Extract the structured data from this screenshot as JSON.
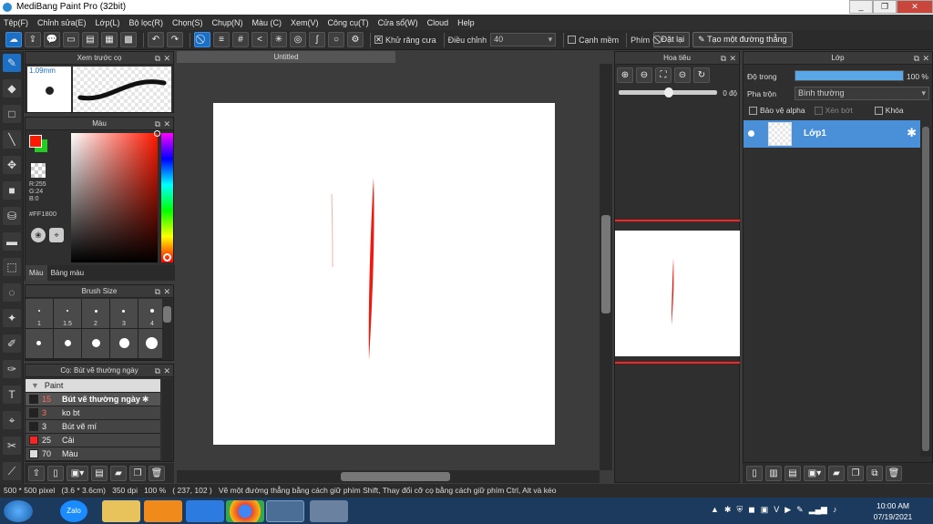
{
  "window": {
    "title": "MediBang Paint Pro (32bit)",
    "minimize": "_",
    "restore": "❐",
    "close": "✕"
  },
  "menu": [
    "Tệp(F)",
    "Chỉnh sửa(E)",
    "Lớp(L)",
    "Bộ lọc(R)",
    "Chọn(S)",
    "Chụp(N)",
    "Màu (C)",
    "Xem(V)",
    "Công cụ(T)",
    "Cửa sổ(W)",
    "Cloud",
    "Help"
  ],
  "toolbar": {
    "antialias_label": "Khử răng cưa",
    "adjust_label": "Điều chỉnh",
    "adjust_value": "40",
    "smooth_label": "Cạnh mềm",
    "key_label": "Phím",
    "reset_label": "Đặt lại",
    "straight_line_label": "Tạo một đường thẳng"
  },
  "brush_preview": {
    "title": "Xem trước cọ",
    "size": "1.09mm"
  },
  "color": {
    "title": "Màu",
    "r": "R:255",
    "g": "G:24",
    "b": "B:0",
    "hex": "#FF1800",
    "tab_color": "Màu",
    "tab_palette": "Bảng màu",
    "primary": "#ff1800",
    "secondary": "#22cc22"
  },
  "brush_size": {
    "title": "Brush Size",
    "labels": [
      "1",
      "1.5",
      "2",
      "3",
      "4"
    ]
  },
  "brush_list": {
    "title": "Cọ: Bút vẽ thường ngày",
    "group": "Paint",
    "items": [
      {
        "num": "15",
        "name": "Bút vẽ thường ngày",
        "color": "#222222"
      },
      {
        "num": "3",
        "name": "ko bt",
        "color": "#222222"
      },
      {
        "num": "3",
        "name": "Bút vẽ mí",
        "color": "#222222"
      },
      {
        "num": "25",
        "name": "Cải",
        "color": "#ff2222"
      },
      {
        "num": "70",
        "name": "Màu",
        "color": "#dddddd"
      }
    ]
  },
  "canvas": {
    "tab_title": "Untitled"
  },
  "navigator": {
    "title": "Hoa tiêu",
    "angle": "0 độ"
  },
  "layers": {
    "title": "Lớp",
    "opacity_label": "Độ trong",
    "opacity_value": "100 %",
    "opacity": 1.0,
    "blend_label": "Pha trộn",
    "blend_value": "Bình thường",
    "protect_alpha": "Bảo vệ alpha",
    "clip": "Xén bớt",
    "lock": "Khóa",
    "layer_name": "Lớp1"
  },
  "status": {
    "size": "500 * 500 pixel",
    "cm": "(3.6 * 3.6cm)",
    "dpi": "350 dpi",
    "zoom": "100 %",
    "coords": "( 237, 102 )",
    "hint": "Vẽ một đường thẳng bằng cách giữ phím Shift, Thay đổi cỡ cọ bằng cách giữ phím Ctrl, Alt và kéo"
  },
  "taskbar": {
    "time": "10:00 AM",
    "date": "07/19/2021",
    "zalo": "Zalo"
  }
}
